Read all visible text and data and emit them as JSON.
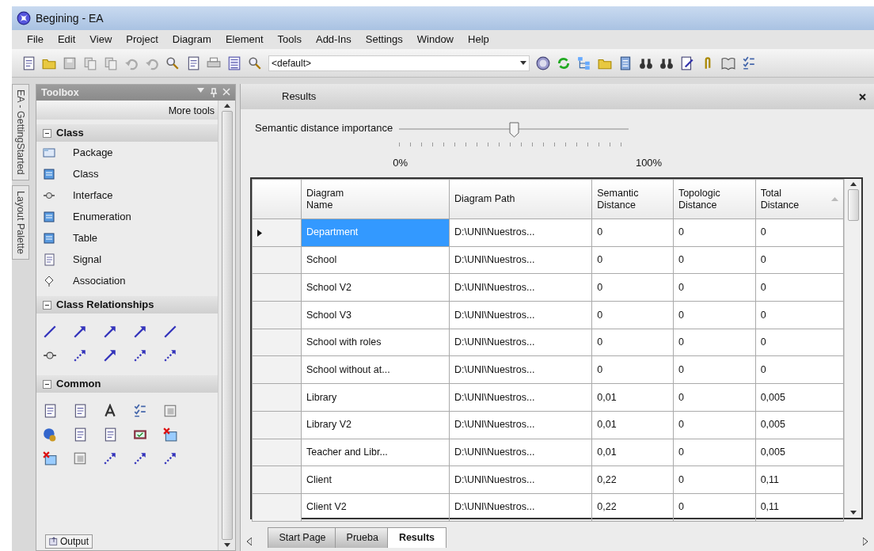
{
  "window": {
    "title": "Begining - EA"
  },
  "menu": [
    "File",
    "Edit",
    "View",
    "Project",
    "Diagram",
    "Element",
    "Tools",
    "Add-Ins",
    "Settings",
    "Window",
    "Help"
  ],
  "toolbar": {
    "combo_value": "<default>"
  },
  "side_tabs": [
    {
      "label": "EA - GettingStarted",
      "selected": false
    },
    {
      "label": "Layout Palette",
      "selected": false
    }
  ],
  "toolbox": {
    "title": "Toolbox",
    "more_tools": "More tools",
    "sections": [
      {
        "title": "Class",
        "expanded": true,
        "kind": "list",
        "items": [
          "Package",
          "Class",
          "Interface",
          "Enumeration",
          "Table",
          "Signal",
          "Association"
        ]
      },
      {
        "title": "Class Relationships",
        "expanded": true,
        "kind": "icons"
      },
      {
        "title": "Common",
        "expanded": true,
        "kind": "icons"
      }
    ]
  },
  "results": {
    "title": "Results",
    "slider": {
      "label": "Semantic distance importance",
      "level": 0.5,
      "min_label": "0%",
      "max_label": "100%"
    },
    "table": {
      "columns": [
        "Diagram\nName",
        "Diagram Path",
        "Semantic\nDistance",
        "Topologic\nDistance",
        "Total\nDistance"
      ],
      "rows": [
        {
          "selected": true,
          "cells": [
            "Department",
            "D:\\UNI\\Nuestros...",
            "0",
            "0",
            "0"
          ]
        },
        {
          "selected": false,
          "cells": [
            "School",
            "D:\\UNI\\Nuestros...",
            "0",
            "0",
            "0"
          ]
        },
        {
          "selected": false,
          "cells": [
            "School V2",
            "D:\\UNI\\Nuestros...",
            "0",
            "0",
            "0"
          ]
        },
        {
          "selected": false,
          "cells": [
            "School V3",
            "D:\\UNI\\Nuestros...",
            "0",
            "0",
            "0"
          ]
        },
        {
          "selected": false,
          "cells": [
            "School with roles",
            "D:\\UNI\\Nuestros...",
            "0",
            "0",
            "0"
          ]
        },
        {
          "selected": false,
          "cells": [
            "School without at...",
            "D:\\UNI\\Nuestros...",
            "0",
            "0",
            "0"
          ]
        },
        {
          "selected": false,
          "cells": [
            "Library",
            "D:\\UNI\\Nuestros...",
            "0,01",
            "0",
            "0,005"
          ]
        },
        {
          "selected": false,
          "cells": [
            "Library V2",
            "D:\\UNI\\Nuestros...",
            "0,01",
            "0",
            "0,005"
          ]
        },
        {
          "selected": false,
          "cells": [
            "Teacher and Libr...",
            "D:\\UNI\\Nuestros...",
            "0,01",
            "0",
            "0,005"
          ]
        },
        {
          "selected": false,
          "cells": [
            "Client",
            "D:\\UNI\\Nuestros...",
            "0,22",
            "0",
            "0,11"
          ]
        },
        {
          "selected": false,
          "cells": [
            "Client V2",
            "D:\\UNI\\Nuestros...",
            "0,22",
            "0",
            "0,11"
          ]
        }
      ]
    }
  },
  "doc_tabs": [
    {
      "label": "Start Page",
      "selected": false
    },
    {
      "label": "Prueba",
      "selected": false
    },
    {
      "label": "Results",
      "selected": true
    }
  ],
  "output_button": "Output"
}
